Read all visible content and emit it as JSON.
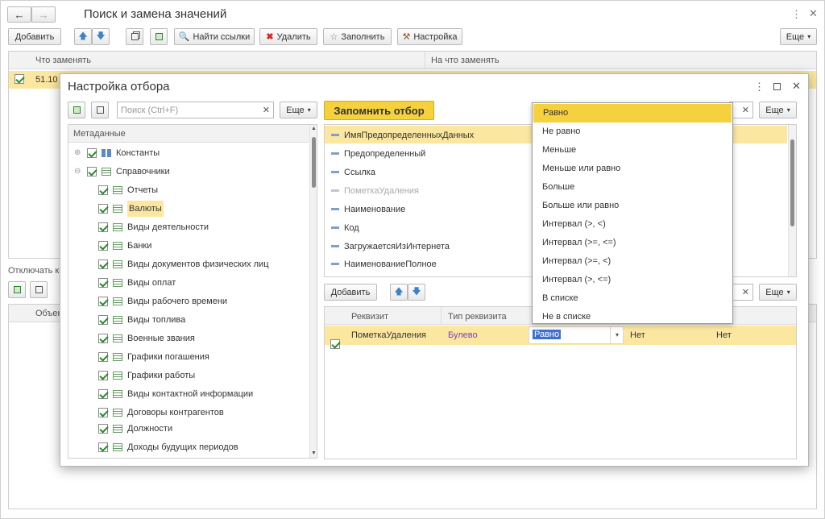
{
  "main": {
    "title": "Поиск и замена значений",
    "toolbar": {
      "add": "Добавить",
      "find_links": "Найти ссылки",
      "delete": "Удалить",
      "fill": "Заполнить",
      "settings": "Настройка",
      "more": "Еще"
    },
    "columns": {
      "what": "Что заменять",
      "with": "На что заменять"
    },
    "row_value": "51.10",
    "disable_label": "Отключать ко",
    "lower_column": "Объек"
  },
  "dialog": {
    "title": "Настройка отбора",
    "search_placeholder": "Поиск (Ctrl+F)",
    "more": "Еще",
    "remember": "Запомнить отбор",
    "tree_header": "Метаданные",
    "tree": [
      {
        "label": "Константы",
        "level": 0,
        "icon": "constants-icon"
      },
      {
        "label": "Справочники",
        "level": 0,
        "icon": "catalog-icon"
      },
      {
        "label": "Отчеты",
        "level": 1
      },
      {
        "label": "Валюты",
        "level": 1,
        "highlighted": true
      },
      {
        "label": "Виды деятельности",
        "level": 1
      },
      {
        "label": "Банки",
        "level": 1
      },
      {
        "label": "Виды документов физических лиц",
        "level": 1
      },
      {
        "label": "Виды оплат",
        "level": 1
      },
      {
        "label": "Виды рабочего времени",
        "level": 1
      },
      {
        "label": "Виды топлива",
        "level": 1
      },
      {
        "label": "Военные звания",
        "level": 1
      },
      {
        "label": "Графики погашения",
        "level": 1
      },
      {
        "label": "Графики работы",
        "level": 1
      },
      {
        "label": "Виды контактной информации",
        "level": 1
      },
      {
        "label": "Договоры контрагентов",
        "level": 1
      },
      {
        "label": "Должности",
        "level": 1
      },
      {
        "label": "Доходы будущих периодов",
        "level": 1
      }
    ],
    "fields": [
      "ИмяПредопределенныхДанных",
      "Предопределенный",
      "Ссылка",
      "ПометкаУдаления",
      "Наименование",
      "Код",
      "ЗагружаетсяИзИнтернета",
      "НаименованиеПолное"
    ],
    "filter_add": "Добавить",
    "filter_columns": {
      "attr": "Реквизит",
      "type": "Тип реквизита"
    },
    "filter_row": {
      "attr": "ПометкаУдаления",
      "type": "Булево",
      "cond": "Равно",
      "v1": "Нет",
      "v2": "Нет"
    },
    "dropdown": [
      "Равно",
      "Не равно",
      "Меньше",
      "Меньше или равно",
      "Больше",
      "Больше или равно",
      "Интервал (>, <)",
      "Интервал (>=, <=)",
      "Интервал (>=, <)",
      "Интервал (>, <=)",
      "В списке",
      "Не в списке"
    ]
  },
  "colors": {
    "accent": "#f5d13d",
    "selected": "#fbe7a0",
    "link": "#7b3fc0"
  }
}
